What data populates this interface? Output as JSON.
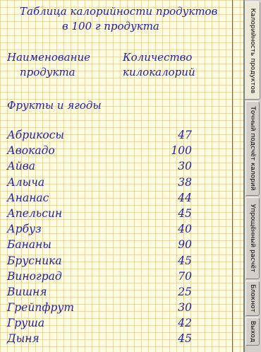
{
  "document": {
    "title_line1": "Таблица калорийности продуктов",
    "title_line2": "в  100 г продукта",
    "col_name_line1": "Наименование",
    "col_name_line2": "продукта",
    "col_qty_line1": "Количество",
    "col_qty_line2": "килокалорий",
    "section": "Фрукты и ягоды",
    "rows": [
      {
        "name": "Абрикосы",
        "kcal": "47"
      },
      {
        "name": "Авокадо",
        "kcal": "100"
      },
      {
        "name": "Айва",
        "kcal": "30"
      },
      {
        "name": "Алыча",
        "kcal": "38"
      },
      {
        "name": "Ананас",
        "kcal": "44"
      },
      {
        "name": "Апельсин",
        "kcal": "45"
      },
      {
        "name": "Арбуз",
        "kcal": "40"
      },
      {
        "name": "Бананы",
        "kcal": "90"
      },
      {
        "name": "Брусника",
        "kcal": "45"
      },
      {
        "name": "Виноград",
        "kcal": "70"
      },
      {
        "name": "Вишня",
        "kcal": "25"
      },
      {
        "name": "Грейпфрут",
        "kcal": "30"
      },
      {
        "name": "Груша",
        "kcal": "42"
      },
      {
        "name": "Дыня",
        "kcal": "45"
      }
    ]
  },
  "tabs": [
    {
      "label": "Калорийность продуктов",
      "active": true
    },
    {
      "label": "Точный подсчёт калорий",
      "active": false
    },
    {
      "label": "Упрощённый расчёт",
      "active": false
    },
    {
      "label": "Блокнот",
      "active": false
    },
    {
      "label": "Выход",
      "active": false
    }
  ],
  "colors": {
    "ink": "#1f1fa8",
    "paper": "#fdfbe2",
    "grid": "#d7be78",
    "margin_line": "#d04040"
  }
}
